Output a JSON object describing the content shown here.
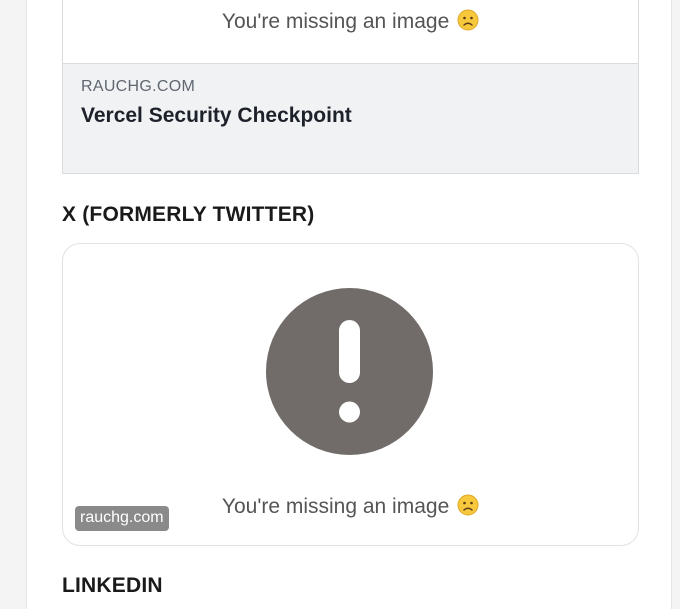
{
  "facebook_preview": {
    "missing_image_text": "You're missing an image",
    "missing_image_emoji": "sad-face-emoji",
    "domain": "RAUCHG.COM",
    "title": "Vercel Security Checkpoint"
  },
  "x_section": {
    "heading": "X (FORMERLY TWITTER)",
    "alert_icon": "exclamation-circle-icon",
    "alert_icon_color": "#716c69",
    "missing_image_text": "You're missing an image",
    "missing_image_emoji": "sad-face-emoji",
    "domain_badge": "rauchg.com"
  },
  "linkedin_section": {
    "heading": "LINKEDIN"
  }
}
